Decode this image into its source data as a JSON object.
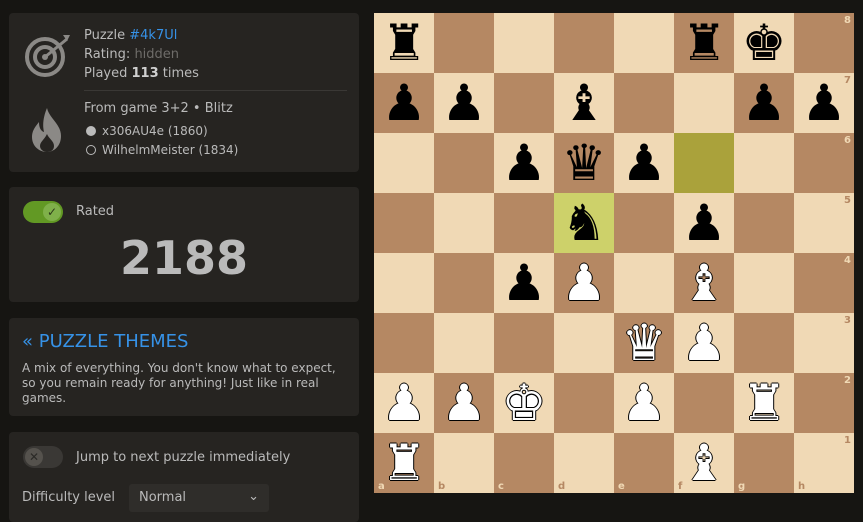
{
  "puzzle": {
    "label": "Puzzle",
    "id": "#4k7Ul",
    "rating_label": "Rating:",
    "rating_value": "hidden",
    "played_prefix": "Played",
    "played_count": "113",
    "played_suffix": "times"
  },
  "game": {
    "from_label": "From game 3+2 • Blitz",
    "white_player": "x306AU4e (1860)",
    "black_player": "WilhelmMeister (1834)"
  },
  "rated": {
    "label": "Rated",
    "toggle_on": true,
    "rating": "2188"
  },
  "themes": {
    "title": "« PUZZLE THEMES",
    "description": "A mix of everything. You don't know what to expect, so you remain ready for anything! Just like in real games."
  },
  "settings": {
    "jump_label": "Jump to next puzzle immediately",
    "jump_on": false,
    "difficulty_label": "Difficulty level",
    "difficulty_value": "Normal"
  },
  "board": {
    "orientation": "white",
    "highlights": [
      "f6",
      "d5"
    ],
    "pieces": [
      {
        "sq": "a8",
        "p": "bR"
      },
      {
        "sq": "f8",
        "p": "bR"
      },
      {
        "sq": "g8",
        "p": "bK"
      },
      {
        "sq": "a7",
        "p": "bP"
      },
      {
        "sq": "b7",
        "p": "bP"
      },
      {
        "sq": "d7",
        "p": "bB"
      },
      {
        "sq": "g7",
        "p": "bP"
      },
      {
        "sq": "h7",
        "p": "bP"
      },
      {
        "sq": "c6",
        "p": "bP"
      },
      {
        "sq": "d6",
        "p": "bQ"
      },
      {
        "sq": "e6",
        "p": "bP"
      },
      {
        "sq": "d5",
        "p": "bN"
      },
      {
        "sq": "f5",
        "p": "bP"
      },
      {
        "sq": "c4",
        "p": "bP"
      },
      {
        "sq": "d4",
        "p": "wP"
      },
      {
        "sq": "f4",
        "p": "wB"
      },
      {
        "sq": "e3",
        "p": "wQ"
      },
      {
        "sq": "f3",
        "p": "wP"
      },
      {
        "sq": "a2",
        "p": "wP"
      },
      {
        "sq": "b2",
        "p": "wP"
      },
      {
        "sq": "c2",
        "p": "wK"
      },
      {
        "sq": "e2",
        "p": "wP"
      },
      {
        "sq": "g2",
        "p": "wR"
      },
      {
        "sq": "a1",
        "p": "wR"
      },
      {
        "sq": "f1",
        "p": "wB"
      }
    ],
    "files": [
      "a",
      "b",
      "c",
      "d",
      "e",
      "f",
      "g",
      "h"
    ],
    "ranks": [
      "8",
      "7",
      "6",
      "5",
      "4",
      "3",
      "2",
      "1"
    ]
  },
  "colors": {
    "accent": "#3692e7",
    "toggle_on": "#629924",
    "light_square": "#f0d9b5",
    "dark_square": "#b58863"
  }
}
